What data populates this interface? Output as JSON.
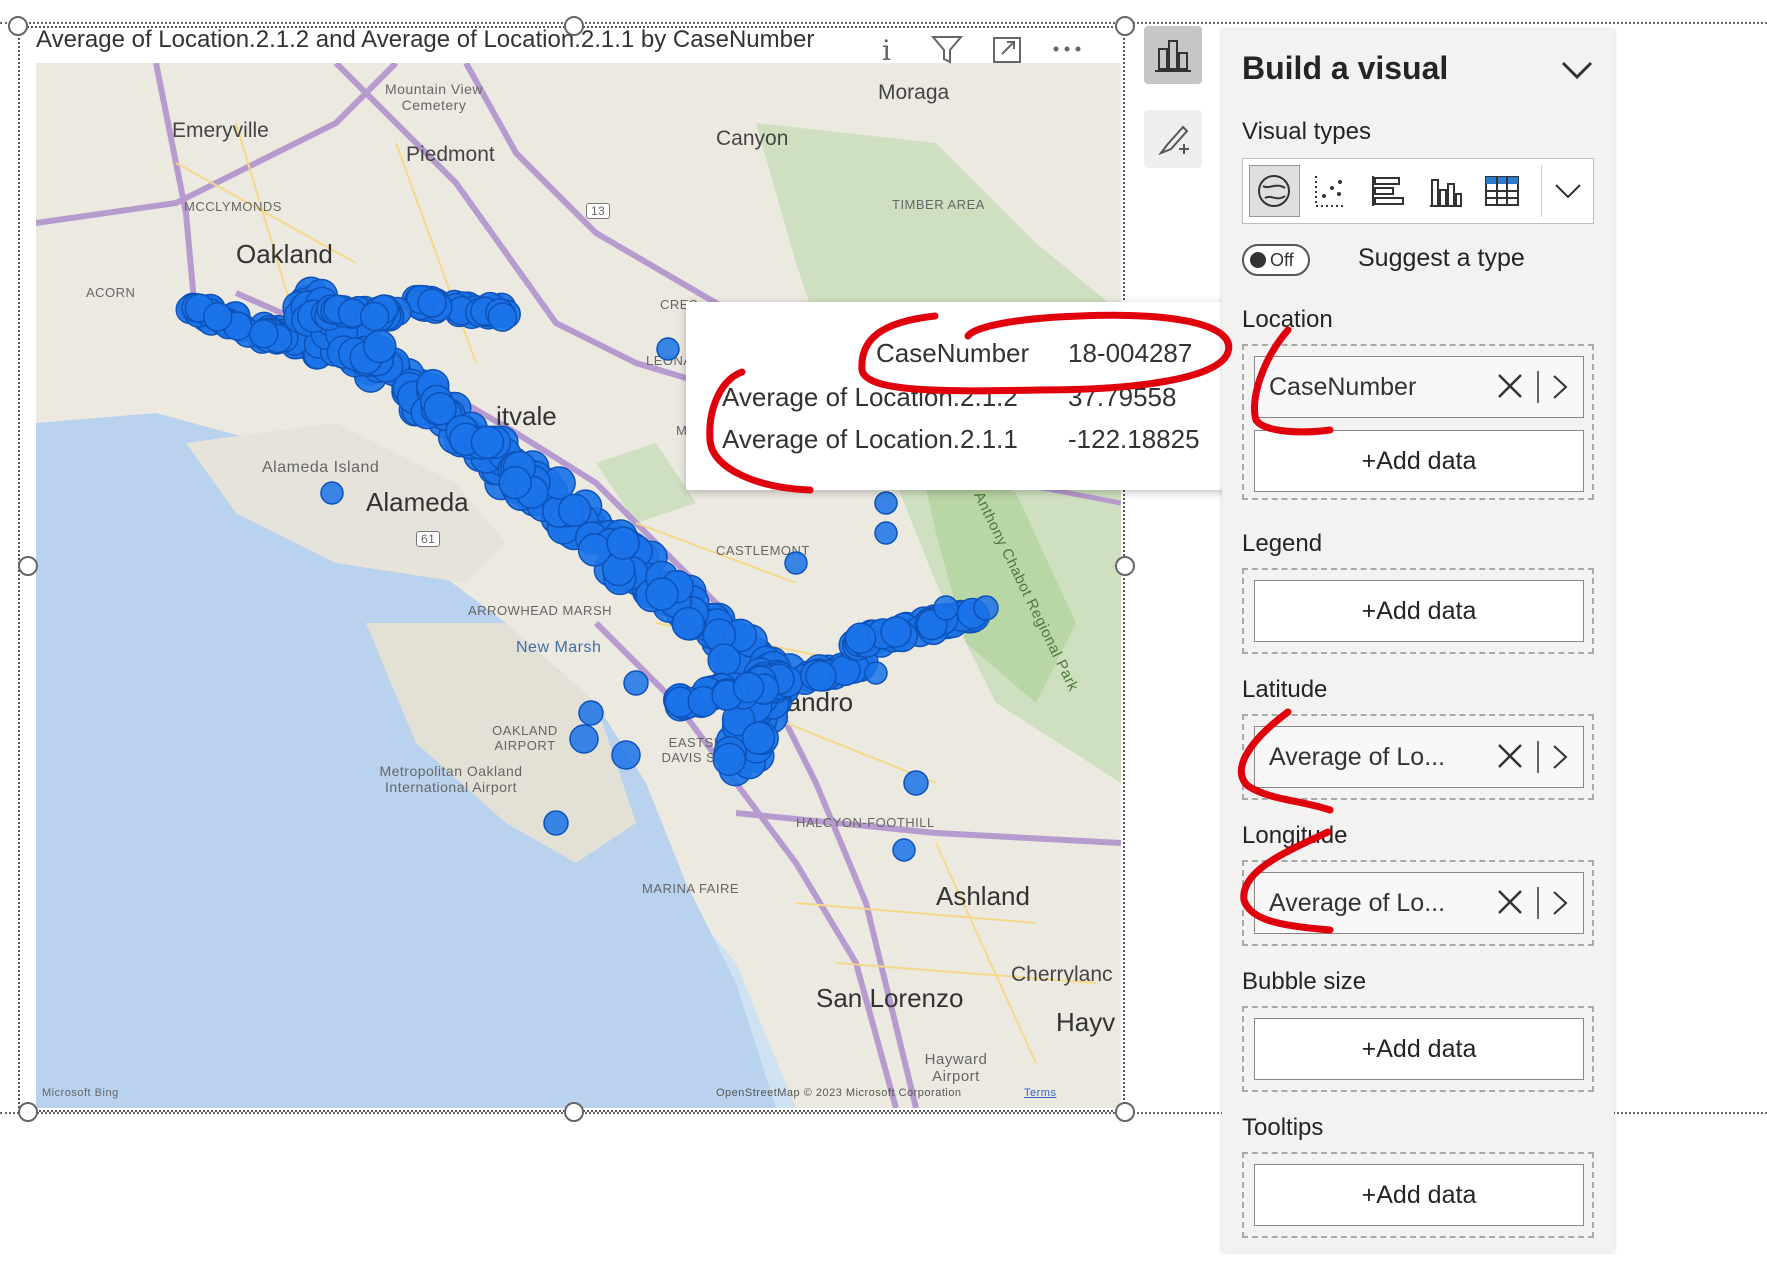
{
  "visual": {
    "title": "Average of Location.2.1.2 and Average of Location.2.1.1 by CaseNumber",
    "header_icons": [
      "info-icon",
      "filter-icon",
      "focus-mode-icon",
      "more-options-icon"
    ]
  },
  "map": {
    "labels": {
      "emeryville": "Emeryville",
      "mountain_view_cemetery": "Mountain View Cemetery",
      "piedmont": "Piedmont",
      "moraga": "Moraga",
      "canyon": "Canyon",
      "mcclymonds": "MCCLYMONDS",
      "oakland": "Oakland",
      "acorn": "ACORN",
      "fruitvale": "itvale",
      "alameda_island": "Alameda Island",
      "alameda": "Alameda",
      "arrowhead_marsh": "ARROWHEAD MARSH",
      "new_marsh": "New Marsh",
      "castlemont": "CASTLEMONT",
      "san_leandro": "n Leandro",
      "oakland_airport": "OAKLAND AIRPORT",
      "eastshore_davis": "EASTSHORE DAVIS STREET",
      "metropolitan_airport": "Metropolitan Oakland International Airport",
      "halcyon_foothill": "HALCYON-FOOTHILL",
      "marina_faire": "MARINA FAIRE",
      "ashland": "Ashland",
      "san_lorenzo": "San Lorenzo",
      "cherryland": "Cherrylanc",
      "hayward": "Hayv",
      "hayward_airport": "Hayward Airport",
      "leona": "LEONA",
      "crest": "CRES",
      "mills": "MI",
      "timber_area": "TIMBER AREA",
      "park": "Anthony Chabot Regional Park",
      "route_13": "13",
      "route_61": "61",
      "copyright": "OpenStreetMap © 2023 Microsoft Corporation",
      "terms": "Terms",
      "bing": "Microsoft Bing"
    },
    "point_color": "#1a73e8"
  },
  "tooltip": {
    "rows": [
      {
        "label": "CaseNumber",
        "value": "18-004287"
      },
      {
        "label": "Average of Location.2.1.2",
        "value": "37.79558"
      },
      {
        "label": "Average of Location.2.1.1",
        "value": "-122.18825"
      }
    ]
  },
  "panel": {
    "title": "Build a visual",
    "visual_types_label": "Visual types",
    "toggle_label": "Off",
    "suggest_label": "Suggest a type",
    "wells": {
      "location": {
        "label": "Location",
        "field": "CaseNumber",
        "add": "+Add data"
      },
      "legend": {
        "label": "Legend",
        "add": "+Add data"
      },
      "latitude": {
        "label": "Latitude",
        "field": "Average of Lo..."
      },
      "longitude": {
        "label": "Longitude",
        "field": "Average of Lo..."
      },
      "bubble_size": {
        "label": "Bubble size",
        "add": "+Add data"
      },
      "tooltips": {
        "label": "Tooltips",
        "add": "+Add data"
      }
    }
  },
  "colors": {
    "annotation": "#e0000c",
    "panel_bg": "#f3f2f1"
  }
}
